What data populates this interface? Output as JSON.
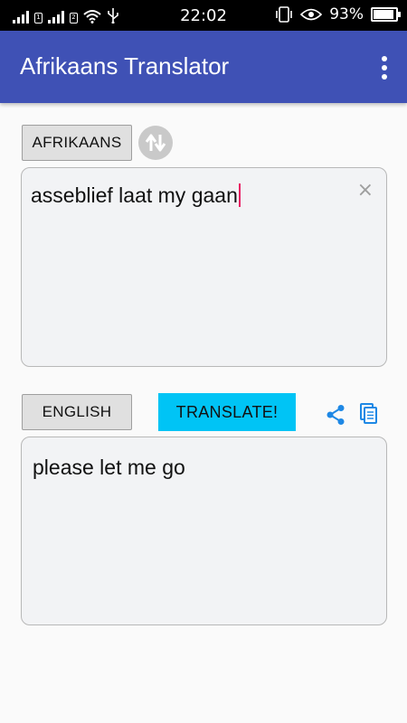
{
  "status_bar": {
    "time": "22:02",
    "battery_percent": "93%",
    "battery_level": 0.93
  },
  "app_bar": {
    "title": "Afrikaans Translator",
    "menu_icon": "overflow-menu-icon"
  },
  "source": {
    "language_label": "AFRIKAANS",
    "text": "asseblief laat my gaan",
    "clear_icon": "×"
  },
  "target": {
    "language_label": "ENGLISH",
    "text": "please let me go"
  },
  "actions": {
    "translate_label": "TRANSLATE!",
    "share_icon": "share-icon",
    "copy_icon": "copy-icon"
  },
  "colors": {
    "app_bar": "#3f51b5",
    "translate_button": "#00c4f5",
    "icon_accent": "#1e88e5",
    "caret": "#e91e63"
  }
}
